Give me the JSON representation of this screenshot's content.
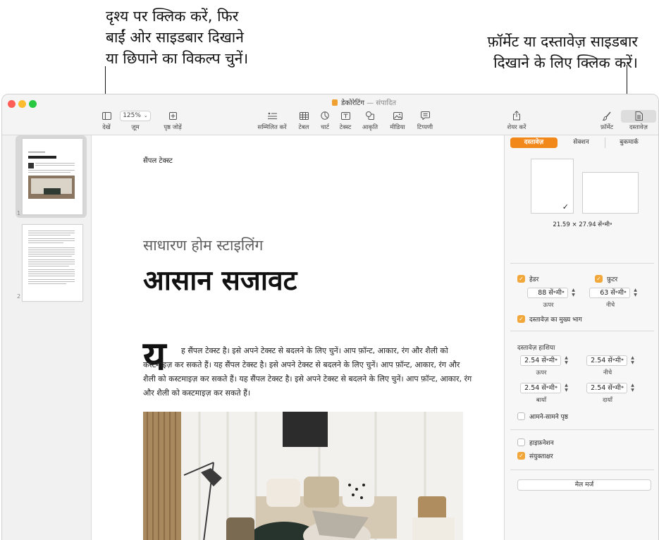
{
  "callouts": {
    "left": [
      "दृश्य पर क्लिक करें, फिर",
      "बाईं ओर साइडबार दिखाने",
      "या छिपाने का विकल्प चुनें।"
    ],
    "right": [
      "फ़ॉर्मेट या दस्तावेज़ साइडबार",
      "दिखाने के लिए क्लिक करें।"
    ]
  },
  "window": {
    "title": "डेकोरेटिंग",
    "title_separator": "—",
    "title_status": "संपादित"
  },
  "toolbar": {
    "view_label": "देखें",
    "zoom_value": "125%",
    "zoom_label": "ज़ूम",
    "add_page_label": "पृष्ठ जोड़ें",
    "insert_label": "सम्मिलित करें",
    "table_label": "टेबल",
    "chart_label": "चार्ट",
    "text_label": "टेक्स्ट",
    "shape_label": "आकृति",
    "media_label": "मीडिया",
    "comment_label": "टिप्पणी",
    "share_label": "शेयर करें",
    "format_label": "फ़ॉर्मेट",
    "document_label": "दस्तावेज़"
  },
  "thumbnails": {
    "page1_number": "1",
    "page2_number": "2"
  },
  "document": {
    "header": "सैंपल टेक्स्ट",
    "subtitle": "साधारण होम स्टाइलिंग",
    "title": "आसान सजावट",
    "dropcap": "य",
    "body": "ह सैंपल टेक्स्ट है। इसे अपने टेक्स्ट से बदलने के लिए चुनें। आप फ़ॉन्ट, आकार, रंग और शैली को कस्टमाइज़ कर सकते हैं। यह सैंपल टेक्स्ट है। इसे अपने टेक्स्ट से बदलने के लिए चुनें। आप फ़ॉन्ट, आकार, रंग और शैली को कस्टमाइज़ कर सकते हैं। यह सैंपल टेक्स्ट है। इसे अपने टेक्स्ट से बदलने के लिए चुनें। आप फ़ॉन्ट, आकार, रंग और शैली को कस्टमाइज़ कर सकते हैं।"
  },
  "sidebar": {
    "tabs": [
      "दस्तावेज़",
      "सेक्शन",
      "बुकमार्क"
    ],
    "paper_size": "21.59 × 27.94 सें॰मी॰",
    "header_label": "हेडर",
    "footer_label": "फ़ुटर",
    "header_value": "88 सें॰मी॰",
    "footer_value": "63 सें॰मी॰",
    "top_label": "ऊपर",
    "bottom_label": "नीचे",
    "body_label": "दस्तावेज़ का मुख्य भाग",
    "margins_title": "दस्तावेज़ हाशिया",
    "margin_top": "2.54 सें॰मी॰",
    "margin_bottom": "2.54 सें॰मी॰",
    "margin_left": "2.54 सें॰मी॰",
    "margin_right": "2.54 सें॰मी॰",
    "margin_top_label": "ऊपर",
    "margin_bottom_label": "नीचे",
    "margin_left_label": "बायाँ",
    "margin_right_label": "दायाँ",
    "facing_pages_label": "आमने-सामने पृष्ठ",
    "hyphenation_label": "हाइफ़नेशन",
    "ligatures_label": "संयुक्ताक्षर",
    "mail_merge_label": "मेल मर्ज",
    "header_checked": true,
    "footer_checked": true,
    "body_checked": true,
    "facing_checked": false,
    "hyphenation_checked": false,
    "ligatures_checked": true
  },
  "colors": {
    "accent": "#f2871a",
    "checkbox": "#f2a73a",
    "close": "#ff5f57",
    "minimize": "#febc2e",
    "zoom": "#28c840"
  }
}
